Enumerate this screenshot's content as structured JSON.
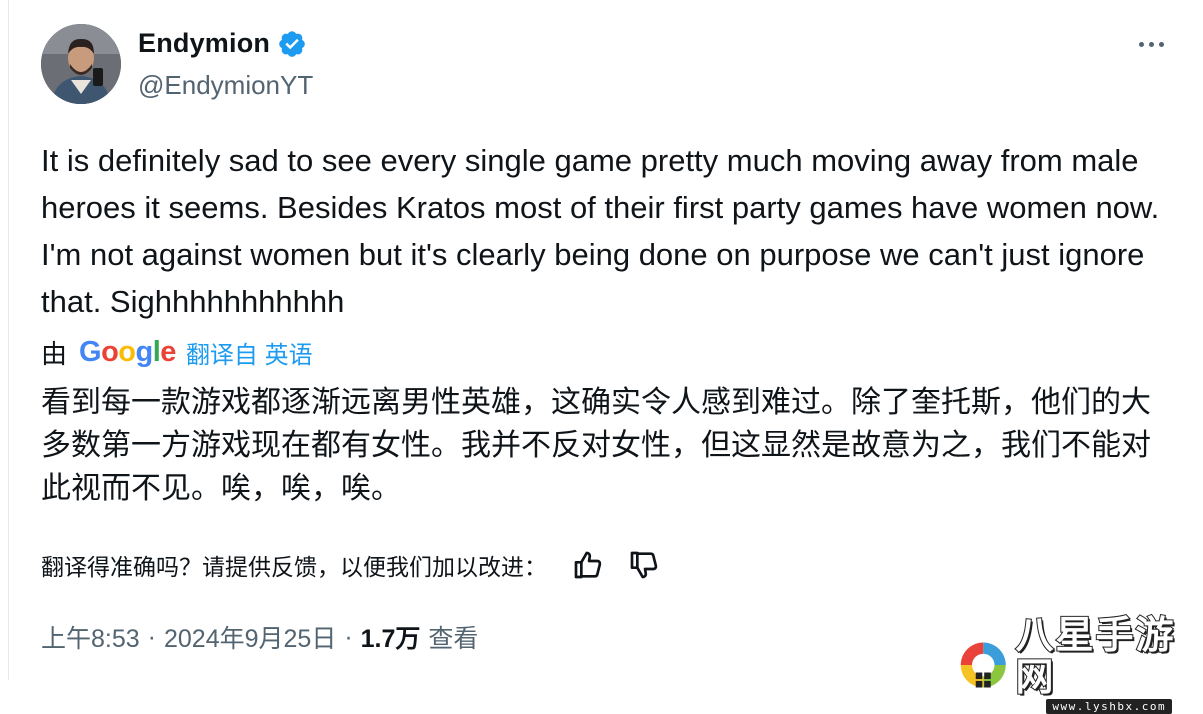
{
  "author": {
    "display_name": "Endymion",
    "handle": "@EndymionYT",
    "verified": true,
    "verified_color": "#1d9bf0"
  },
  "menu": {
    "icon": "more-horizontal-icon"
  },
  "tweet": {
    "text": "It is definitely sad to see every single game pretty much moving away from male heroes it seems. Besides Kratos most of their first party games have women now. I'm not against women but it's clearly being done on purpose we can't just ignore that. Sighhhhhhhhhhh"
  },
  "translation": {
    "by_label": "由",
    "provider": "Google",
    "from_label": "翻译自 英语",
    "text": "看到每一款游戏都逐渐远离男性英雄，这确实令人感到难过。除了奎托斯，他们的大多数第一方游戏现在都有女性。我并不反对女性，但这显然是故意为之，我们不能对此视而不见。唉，唉，唉。"
  },
  "feedback": {
    "label": "翻译得准确吗？请提供反馈，以便我们加以改进：",
    "like_icon": "thumbs-up-icon",
    "dislike_icon": "thumbs-down-icon"
  },
  "meta": {
    "time": "上午8:53",
    "separator": "·",
    "date": "2024年9月25日",
    "views_count": "1.7万",
    "views_label": "查看"
  },
  "watermark": {
    "title": "八星手游网",
    "url": "www.lyshbx.com"
  },
  "colors": {
    "text": "#0f1419",
    "secondary": "#536471",
    "link": "#1d9bf0"
  }
}
